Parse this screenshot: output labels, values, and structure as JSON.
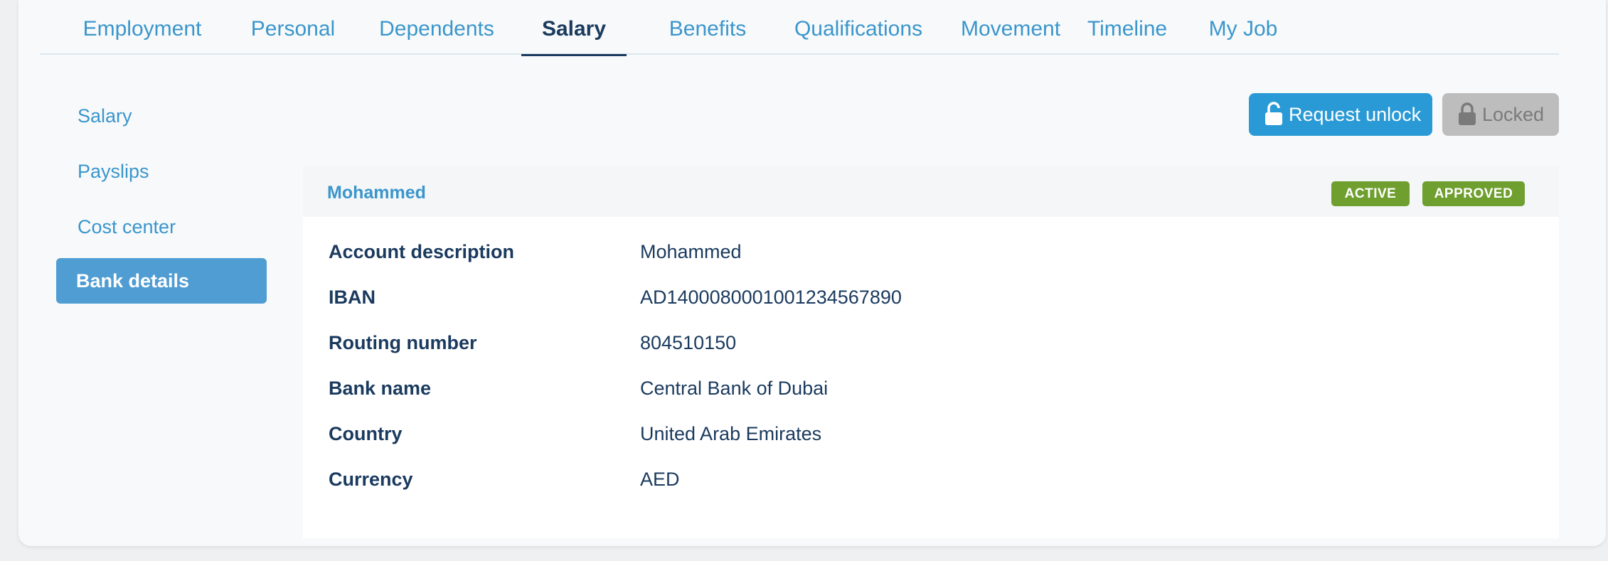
{
  "tabs": [
    {
      "label": "Employment"
    },
    {
      "label": "Personal"
    },
    {
      "label": "Dependents"
    },
    {
      "label": "Salary",
      "active": true
    },
    {
      "label": "Benefits"
    },
    {
      "label": "Qualifications"
    },
    {
      "label": "Movement"
    },
    {
      "label": "Timeline"
    },
    {
      "label": "My Job"
    }
  ],
  "sidebar": {
    "items": [
      {
        "label": "Salary"
      },
      {
        "label": "Payslips"
      },
      {
        "label": "Cost center"
      },
      {
        "label": "Bank details",
        "active": true
      }
    ]
  },
  "actions": {
    "request_unlock_label": "Request unlock",
    "locked_label": "Locked"
  },
  "record": {
    "title": "Mohammed",
    "badges": [
      "ACTIVE",
      "APPROVED"
    ],
    "fields": [
      {
        "label": "Account description",
        "value": "Mohammed"
      },
      {
        "label": "IBAN",
        "value": "AD1400080001001234567890"
      },
      {
        "label": "Routing number",
        "value": "804510150"
      },
      {
        "label": "Bank name",
        "value": "Central Bank of Dubai"
      },
      {
        "label": "Country",
        "value": "United Arab Emirates"
      },
      {
        "label": "Currency",
        "value": "AED"
      }
    ]
  },
  "colors": {
    "accent": "#3a96cc",
    "primary_text": "#1a3a5e",
    "sidebar_active_bg": "#4f9dd2",
    "button_primary": "#2a9ad6",
    "button_disabled": "#bdbdbd",
    "badge_green": "#6f9f2e"
  }
}
